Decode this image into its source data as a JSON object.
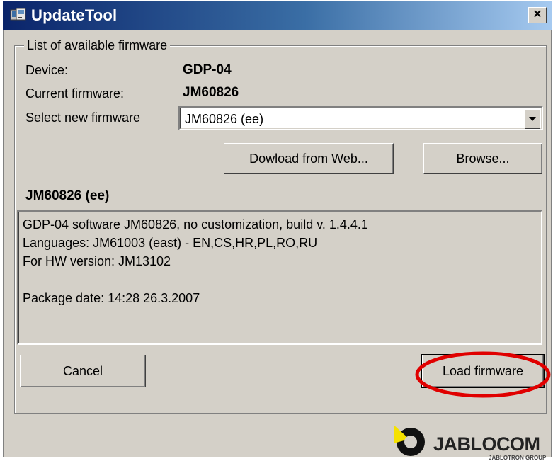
{
  "window": {
    "title": "UpdateTool",
    "close_label": "×"
  },
  "group": {
    "legend": "List of available firmware"
  },
  "device": {
    "label": "Device:",
    "value": "GDP-04"
  },
  "current_firmware": {
    "label": "Current firmware:",
    "value": "JM60826"
  },
  "select_firmware": {
    "label": "Select new firmware",
    "selected": "JM60826 (ee)"
  },
  "buttons": {
    "download": "Dowload from Web...",
    "browse": "Browse...",
    "cancel": "Cancel",
    "load": "Load firmware"
  },
  "selected_heading": "JM60826 (ee)",
  "description": {
    "text": "GDP-04 software JM60826, no customization, build v. 1.4.4.1\nLanguages: JM61003 (east) - EN,CS,HR,PL,RO,RU\nFor HW version: JM13102\n\nPackage date: 14:28 26.3.2007"
  },
  "logo": {
    "name": "JABLOCOM",
    "subtitle": "JABLOTRON GROUP",
    "accent_color": "#f5e100"
  },
  "highlight": {
    "color": "#e00000",
    "target": "load-firmware-button"
  }
}
